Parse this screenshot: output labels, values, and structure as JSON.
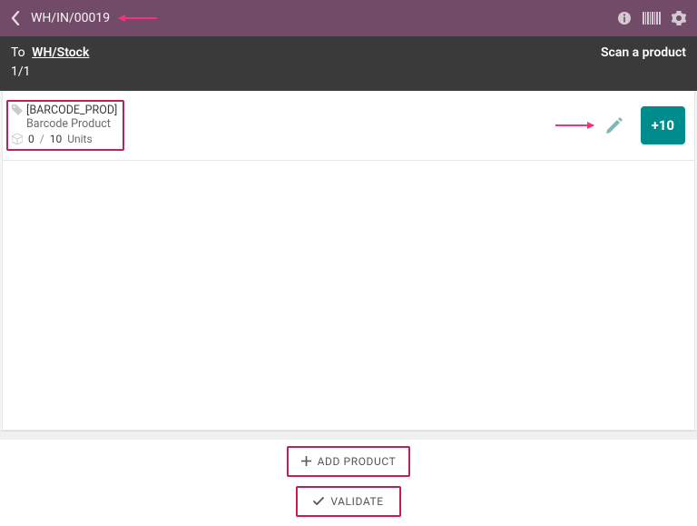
{
  "header": {
    "title": "WH/IN/00019"
  },
  "subheader": {
    "to_label": "To",
    "location": "WH/Stock",
    "count": "1/1",
    "scan_label": "Scan a product"
  },
  "product": {
    "code": "[BARCODE_PROD]",
    "name": "Barcode Product",
    "qty_done": "0",
    "qty_sep": "/",
    "qty_expected": "10",
    "uom": "Units",
    "plus_label": "+10"
  },
  "buttons": {
    "add_product": "ADD PRODUCT",
    "validate": "VALIDATE"
  }
}
